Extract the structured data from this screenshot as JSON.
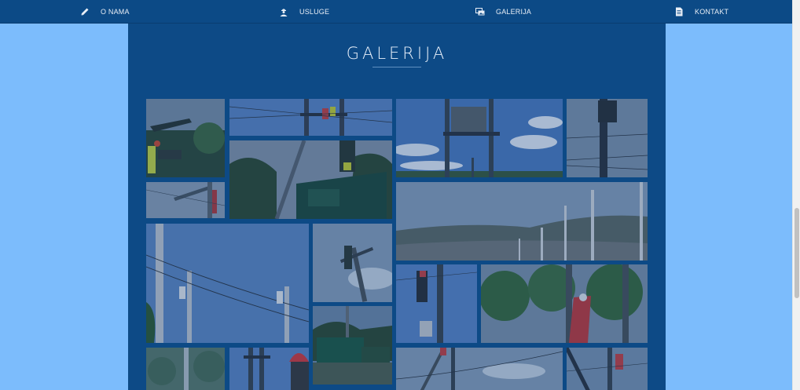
{
  "nav": {
    "items": [
      {
        "label": "O NAMA",
        "icon": "pencil-icon"
      },
      {
        "label": "USLUGE",
        "icon": "worker-icon"
      },
      {
        "label": "GALERIJA",
        "icon": "images-icon"
      },
      {
        "label": "KONTAKT",
        "icon": "document-icon"
      }
    ]
  },
  "gallery": {
    "title": "GALERIJA",
    "photo_count": 17
  },
  "colors": {
    "nav_bg": "#0c4a86",
    "panel_bg": "#0d4a86",
    "page_bg": "#7cbcfc",
    "nav_text": "#e8eef6"
  }
}
